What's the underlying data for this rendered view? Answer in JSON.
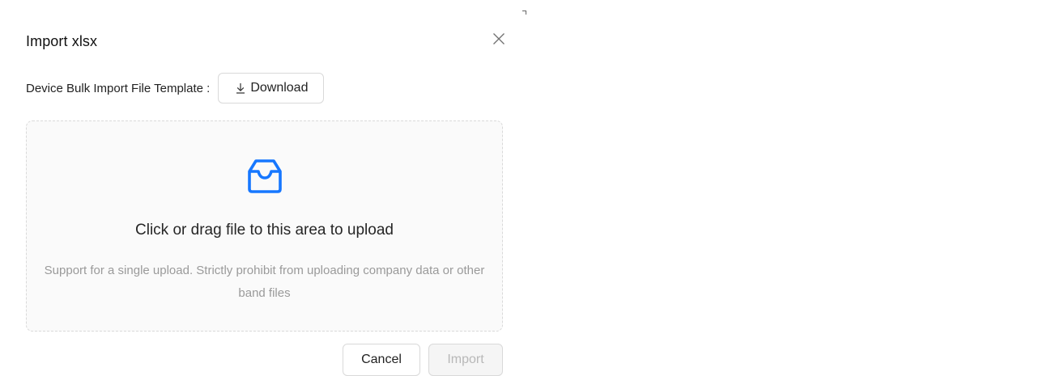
{
  "modal": {
    "title": "Import xlsx",
    "close_icon": "close-icon"
  },
  "template": {
    "label": "Device Bulk Import File Template :",
    "download_label": "Download",
    "download_icon": "download-icon"
  },
  "dropzone": {
    "icon": "inbox-icon",
    "text": "Click or drag file to this area to upload",
    "hint": "Support for a single upload. Strictly prohibit from uploading company data or other band files",
    "accent_color": "#1677ff"
  },
  "footer": {
    "cancel_label": "Cancel",
    "import_label": "Import"
  }
}
